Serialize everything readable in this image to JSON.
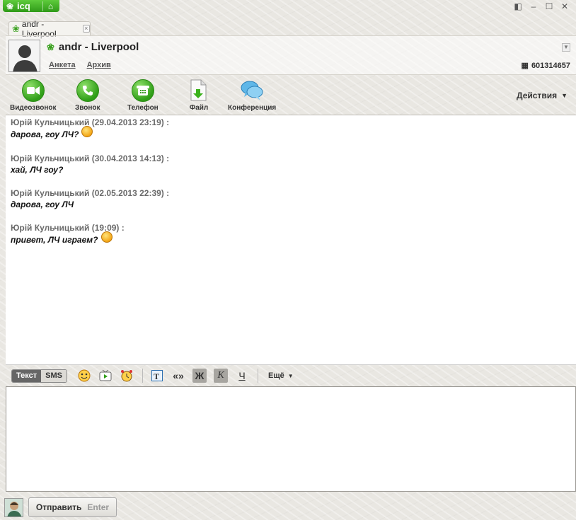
{
  "window": {
    "app_name": "icq",
    "controls": [
      "restore-icon",
      "minimize-icon",
      "maximize-icon",
      "close-icon"
    ]
  },
  "tab": {
    "label": "andr - Liverpool"
  },
  "contact": {
    "name": "andr - Liverpool",
    "uin": "601314657",
    "links": [
      "Анкета",
      "Архив"
    ]
  },
  "toolbar": {
    "buttons": [
      {
        "label": "Видеозвонок",
        "icon": "video-camera-icon"
      },
      {
        "label": "Звонок",
        "icon": "phone-handset-icon"
      },
      {
        "label": "Телефон",
        "icon": "desk-phone-icon"
      },
      {
        "label": "Файл",
        "icon": "file-icon"
      },
      {
        "label": "Конференция",
        "icon": "conference-icon"
      }
    ],
    "actions_label": "Действия"
  },
  "messages": [
    {
      "header": "Юрій Кульчицький (29.04.2013 23:19) :",
      "text": "дарова, гоу ЛЧ?",
      "emoticon": true
    },
    {
      "header": "Юрій Кульчицький (30.04.2013 14:13) :",
      "text": "хай, ЛЧ гоу?",
      "emoticon": false
    },
    {
      "header": "Юрій Кульчицький (02.05.2013 22:39) :",
      "text": "дарова, гоу ЛЧ",
      "emoticon": false
    },
    {
      "header": "Юрій Кульчицький (19:09) :",
      "text": "привет, ЛЧ играем?",
      "emoticon": true
    }
  ],
  "format_bar": {
    "mode_text": "Текст",
    "mode_sms": "SMS",
    "quote": "«»",
    "bold": "Ж",
    "italic": "К",
    "underline": "Ч",
    "more": "Ещё"
  },
  "input": {
    "value": "",
    "placeholder": ""
  },
  "send": {
    "label": "Отправить",
    "hint": "Enter"
  },
  "colors": {
    "accent_green": "#3aa11f",
    "text_gray": "#6a6a6a"
  }
}
